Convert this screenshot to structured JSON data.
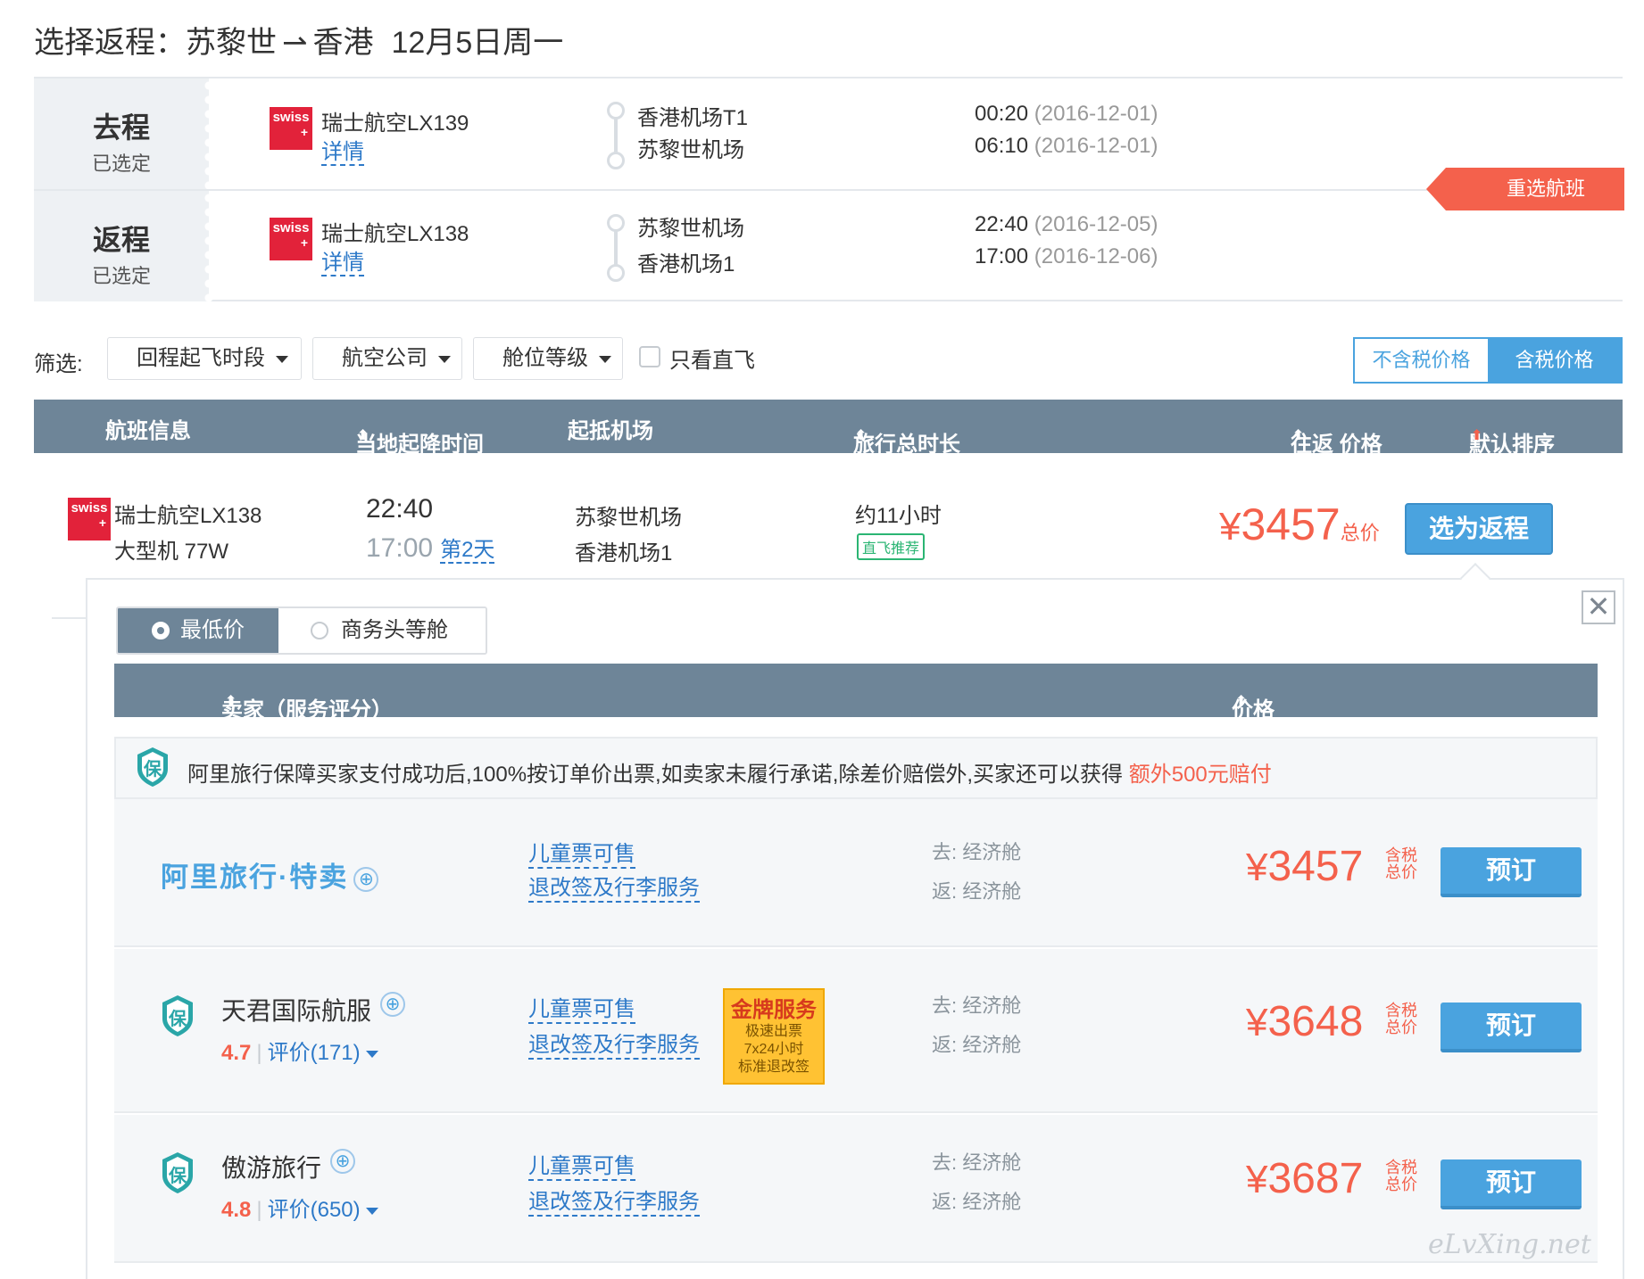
{
  "header": {
    "title_prefix": "选择返程：苏黎世",
    "arrow": "⇀",
    "title_dest": "香港",
    "date": "12月5日周一"
  },
  "selected": {
    "outbound": {
      "tag": "去程",
      "status": "已选定",
      "airline": "瑞士航空LX139",
      "detail": "详情",
      "from_airport": "香港机场T1",
      "to_airport": "苏黎世机场",
      "dep_time": "00:20",
      "dep_date": "(2016-12-01)",
      "arr_time": "06:10",
      "arr_date": "(2016-12-01)"
    },
    "return": {
      "tag": "返程",
      "status": "已选定",
      "airline": "瑞士航空LX138",
      "detail": "详情",
      "from_airport": "苏黎世机场",
      "to_airport": "香港机场1",
      "dep_time": "22:40",
      "dep_date": "(2016-12-05)",
      "arr_time": "17:00",
      "arr_date": "(2016-12-06)"
    },
    "reselect_label": "重选航班",
    "logo_text": "swiss",
    "logo_plus": "+"
  },
  "filters": {
    "label": "筛选:",
    "return_time": "回程起飞时段",
    "airline": "航空公司",
    "cabin_class": "舱位等级",
    "direct_only": "只看直飞",
    "price_no_tax": "不含税价格",
    "price_with_tax": "含税价格"
  },
  "table_header": {
    "flight_info": "航班信息",
    "local_time": "当地起降时间",
    "airports": "起抵机场",
    "duration": "旅行总时长",
    "price": "往返 价格",
    "sort": "默认排序",
    "arrow": "⬆"
  },
  "flight": {
    "airline": "瑞士航空LX138",
    "aircraft": "大型机 77W",
    "dep_time": "22:40",
    "arr_time": "17:00",
    "next_day": "第2天",
    "dep_airport": "苏黎世机场",
    "arr_airport": "香港机场1",
    "duration": "约11小时",
    "tag": "直飞推荐",
    "currency": "¥",
    "price": "3457",
    "price_unit": "总价",
    "select_label": "选为返程"
  },
  "seller_panel": {
    "close": "✕",
    "tab_lowest": "最低价",
    "tab_business": "商务头等舱",
    "header_seller": "卖家（服务评分）",
    "header_price": "价格",
    "arrow": "⬆",
    "guarantee_text": "阿里旅行保障买家支付成功后,100%按订单价出票,如卖家未履行承诺,除差价赔偿外,买家还可以获得",
    "guarantee_highlight": "额外500元赔付",
    "guarantee_icon": "保",
    "sellers": [
      {
        "name": "阿里旅行·特卖",
        "badge": "⊕",
        "child": "儿童票可售",
        "policy": "退改签及行李服务",
        "out_label": "去:",
        "out_cabin": "经济舱",
        "ret_label": "返:",
        "ret_cabin": "经济舱",
        "currency": "¥",
        "price": "3457",
        "tax_label": "含税总价",
        "book": "预订"
      },
      {
        "name": "天君国际航服",
        "badge": "⊕",
        "icon": "保",
        "score": "4.7",
        "reviews": "评价(171)",
        "child": "儿童票可售",
        "policy": "退改签及行李服务",
        "gold_title": "金牌服务",
        "gold_l1": "极速出票",
        "gold_l2": "7x24小时",
        "gold_l3": "标准退改签",
        "out_label": "去:",
        "out_cabin": "经济舱",
        "ret_label": "返:",
        "ret_cabin": "经济舱",
        "currency": "¥",
        "price": "3648",
        "tax_label": "含税总价",
        "book": "预订"
      },
      {
        "name": "傲游旅行",
        "badge": "⊕",
        "icon": "保",
        "score": "4.8",
        "reviews": "评价(650)",
        "child": "儿童票可售",
        "policy": "退改签及行李服务",
        "out_label": "去:",
        "out_cabin": "经济舱",
        "ret_label": "返:",
        "ret_cabin": "经济舱",
        "currency": "¥",
        "price": "3687",
        "tax_label": "含税总价",
        "book": "预订"
      }
    ]
  },
  "watermark": "eLvXing.net",
  "colors": {
    "accent_blue": "#4aa3df",
    "link_blue": "#2d79c8",
    "price_red": "#f4614c",
    "header_slate": "#6e8598",
    "swiss_red": "#e2223a",
    "gold": "#ffc233",
    "direct_green": "#2bb573"
  }
}
